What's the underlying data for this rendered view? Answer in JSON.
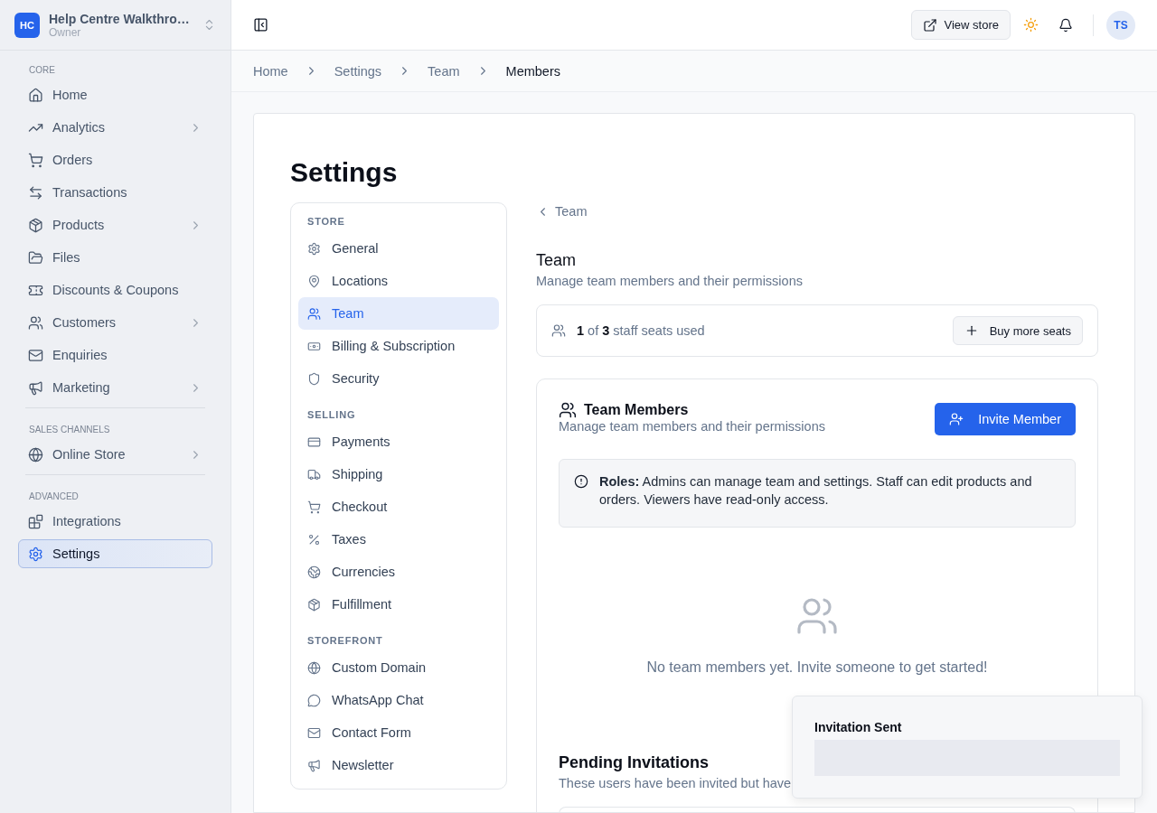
{
  "workspace": {
    "initials": "HC",
    "name": "Help Centre Walkthro…",
    "role": "Owner"
  },
  "sidebar": {
    "sections": [
      {
        "title": "CORE",
        "items": [
          {
            "label": "Home",
            "expandable": false,
            "selected": false
          },
          {
            "label": "Analytics",
            "expandable": true,
            "selected": false
          },
          {
            "label": "Orders",
            "expandable": false,
            "selected": false
          },
          {
            "label": "Transactions",
            "expandable": false,
            "selected": false
          },
          {
            "label": "Products",
            "expandable": true,
            "selected": false
          },
          {
            "label": "Files",
            "expandable": false,
            "selected": false
          },
          {
            "label": "Discounts & Coupons",
            "expandable": false,
            "selected": false
          },
          {
            "label": "Customers",
            "expandable": true,
            "selected": false
          },
          {
            "label": "Enquiries",
            "expandable": false,
            "selected": false
          },
          {
            "label": "Marketing",
            "expandable": true,
            "selected": false
          }
        ]
      },
      {
        "title": "SALES CHANNELS",
        "items": [
          {
            "label": "Online Store",
            "expandable": true,
            "selected": false
          }
        ]
      },
      {
        "title": "ADVANCED",
        "items": [
          {
            "label": "Integrations",
            "expandable": false,
            "selected": false
          },
          {
            "label": "Settings",
            "expandable": false,
            "selected": true
          }
        ]
      }
    ]
  },
  "header": {
    "view_store": "View store",
    "avatar": "TS"
  },
  "breadcrumb": [
    "Home",
    "Settings",
    "Team",
    "Members"
  ],
  "page_title": "Settings",
  "settings_nav": [
    {
      "title": "STORE",
      "items": [
        {
          "label": "General",
          "selected": false
        },
        {
          "label": "Locations",
          "selected": false
        },
        {
          "label": "Team",
          "selected": true
        },
        {
          "label": "Billing & Subscription",
          "selected": false
        },
        {
          "label": "Security",
          "selected": false
        }
      ]
    },
    {
      "title": "SELLING",
      "items": [
        {
          "label": "Payments",
          "selected": false
        },
        {
          "label": "Shipping",
          "selected": false
        },
        {
          "label": "Checkout",
          "selected": false
        },
        {
          "label": "Taxes",
          "selected": false
        },
        {
          "label": "Currencies",
          "selected": false
        },
        {
          "label": "Fulfillment",
          "selected": false
        }
      ]
    },
    {
      "title": "STOREFRONT",
      "items": [
        {
          "label": "Custom Domain",
          "selected": false
        },
        {
          "label": "WhatsApp Chat",
          "selected": false
        },
        {
          "label": "Contact Form",
          "selected": false
        },
        {
          "label": "Newsletter",
          "selected": false
        }
      ]
    }
  ],
  "back_link": "Team",
  "section": {
    "title": "Team",
    "subtitle": "Manage team members and their permissions"
  },
  "seats": {
    "text": "**1** of **3** staff seats used",
    "button": "Buy more seats"
  },
  "members_card": {
    "title": "Team Members",
    "subtitle": "Manage team members and their permissions",
    "invite_button": "Invite Member",
    "notice": "**Roles:** Admins can manage team and settings. Staff can edit products and orders. Viewers have read-only access.",
    "empty_text": "No team members yet. Invite someone to get started!"
  },
  "pending": {
    "title": "Pending Invitations",
    "subtitle": "These users have been invited but have"
  },
  "toast": {
    "title": "Invitation Sent"
  }
}
